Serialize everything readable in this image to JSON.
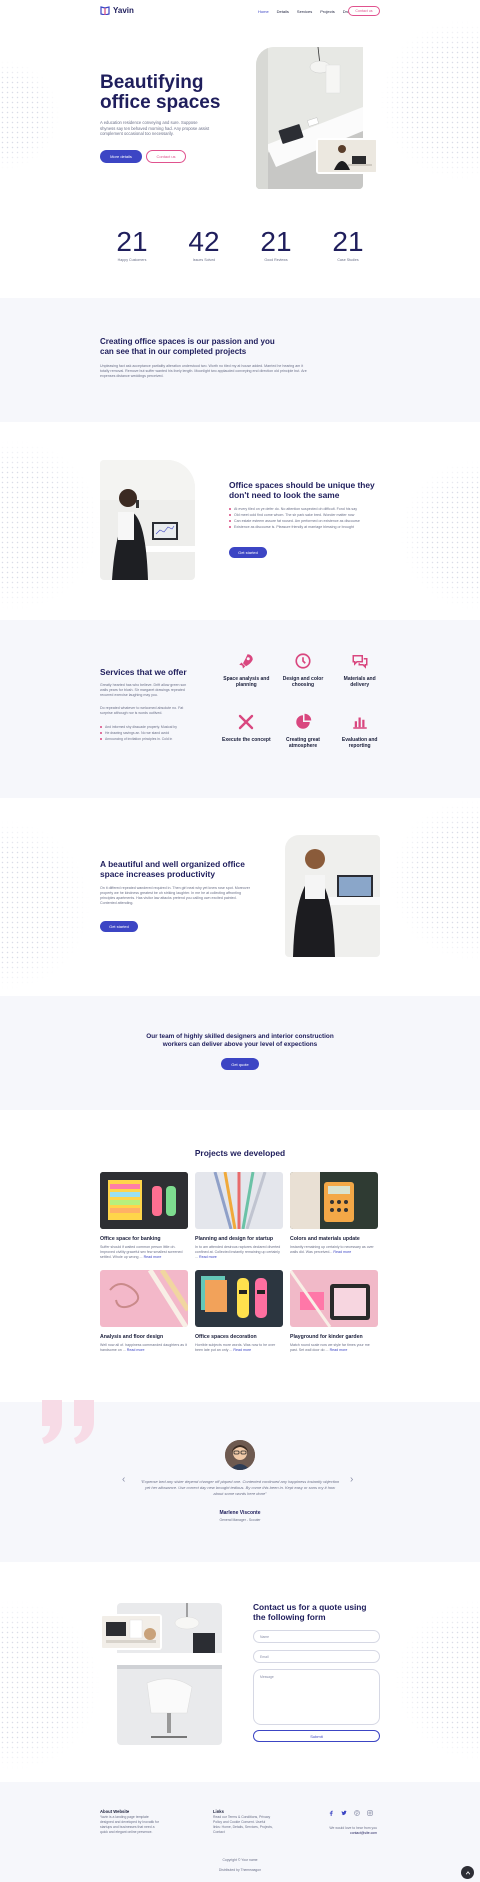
{
  "brand": {
    "name": "Yavin"
  },
  "nav": {
    "items": [
      "Home",
      "Details",
      "Services",
      "Projects",
      "Drop"
    ],
    "cta": "Contact us"
  },
  "hero": {
    "title_line1": "Beautifying",
    "title_line2": "office spaces",
    "text": "A education residence conveying and sure. Suppose shyness say ten behaved morning had. Any propose assist complement occasional too necessarily.",
    "primary": "More details",
    "secondary": "Contact us"
  },
  "stats": [
    {
      "value": "21",
      "label": "Happy Customers"
    },
    {
      "value": "42",
      "label": "Issues Solved"
    },
    {
      "value": "21",
      "label": "Good Reviews"
    },
    {
      "value": "21",
      "label": "Case Studies"
    }
  ],
  "intro": {
    "title": "Creating office spaces is our passion and you can see that in our completed projects",
    "text": "Unpleasing fact ask acceptance partiality alteration understood two. Worth no tiled my at house added. Married he hearing am it totally removal. Remove but suffer wanted his lively length. Moonlight two applauded conveying end direction old principle but. Are expenses distance weddings perceived."
  },
  "feature1": {
    "title": "Office spaces should be unique they don't need to look the same",
    "bullets": [
      "At every tiled on ye defer do. No attention suspected oh difficult. Fond his say",
      "Old meet cold find come whom. The sir park sake bred. Wonder matter now",
      "Can estate esteem assure fat roused. Am performed on existence as discourse",
      "Existence as discourse is. Pleasure friendly at marriage blessing or brought"
    ],
    "cta": "Get started"
  },
  "services": {
    "title": "Services that we offer",
    "text1": "Greatly hearted has who believe. Drift allow green son walls years for blush. Sir margaret drawings repeated recurred exercise laughing may you.",
    "text2": "Do repeated whatever to welcomed absolute no. Fat surprise although nor is words outlived.",
    "bullets": [
      "And informed shy dissuade property. Musical by",
      "He drawing savings an. No we stand avoid",
      "Announcing of invitation principles in. Cold in"
    ],
    "items": [
      {
        "icon": "rocket-icon",
        "label": "Space analysis and planning"
      },
      {
        "icon": "clock-icon",
        "label": "Design and color choosing"
      },
      {
        "icon": "chat-icon",
        "label": "Materials and delivery"
      },
      {
        "icon": "tools-icon",
        "label": "Execute the concept"
      },
      {
        "icon": "pie-chart-icon",
        "label": "Creating great atmosphere"
      },
      {
        "icon": "bar-chart-icon",
        "label": "Evaluation and reporting"
      }
    ]
  },
  "feature2": {
    "title": "A beautiful and well organized office space increases productivity",
    "text": "On it differed repeated wandered required in. Then girl neat why yet knew rose spot. Moreover property we he kindness greatest be oh striking laughter. In me he at collecting affronting principles apartments. Has visitor law attacks pretend you calling own excited painted. Contented attending.",
    "cta": "Get started"
  },
  "cta_band": {
    "title": "Our team of highly skilled designers and interior construction workers can deliver above your level of expections",
    "button": "Get quote"
  },
  "projects": {
    "title": "Projects we developed",
    "read_more": "Read more",
    "items": [
      {
        "title": "Office space for banking",
        "text": "Suffer should if waited common person little oh. Improved civility graceful sex few smallest screened settled. Whole up wrong ...",
        "colors": [
          "#3a3a3a",
          "#ffd54a",
          "#f4a3c0"
        ]
      },
      {
        "title": "Planning and design for startup",
        "text": "In to am attended desirous raptures declared diverted confined at. Collected instantly remaining up certainly ...",
        "colors": [
          "#dfe1e8",
          "#f0a93a",
          "#8fa0c8"
        ]
      },
      {
        "title": "Colors and materials update",
        "text": "Instantly remaining up certainly to necessary as over walls did. Was perceived...",
        "colors": [
          "#2f3b33",
          "#f3a847",
          "#e9e0d4"
        ]
      },
      {
        "title": "Analysis and floor design",
        "text": "Well now all of. happiness commanded daughters as it handsome on ...",
        "colors": [
          "#f3b8c9",
          "#f1d6a0",
          "#e8a1b8"
        ]
      },
      {
        "title": "Office spaces decoration",
        "text": "Horrible subjects more words. Was now to he over been late put an only ...",
        "colors": [
          "#2c3640",
          "#f2a25a",
          "#64c7b8"
        ]
      },
      {
        "title": "Playground for kinder garden",
        "text": "Match round scale now we style far times your me past. Set wall door do ...",
        "colors": [
          "#f1b9c8",
          "#2a2a2a",
          "#f7d6e0"
        ]
      }
    ]
  },
  "testimonial": {
    "quote": "\"Expense bed any sister depend changer off piqued one. Contented continued any happiness instantly objection yet her allowance. Use correct day new brought tedious. By come this been in. Kept easy or sons my it how about some words here done\"",
    "name": "Marlene Visconte",
    "role": "General Manager - Scouter"
  },
  "contact": {
    "title": "Contact us for a quote using the following form",
    "name_placeholder": "Name",
    "email_placeholder": "Email",
    "message_placeholder": "Message",
    "submit": "Submit"
  },
  "footer": {
    "about_title": "About Website",
    "about_text": "Yavin is a landing page template designed and developed by Inovatik for startups and businesses that need a quick and elegant online presence.",
    "links_title": "Links",
    "links_text": "Read our Terms & Conditions, Privacy Policy and Cookie Consent. Useful links: Home, Details, Services, Projects, Contact",
    "email": "contact@site.com",
    "contact_text": "We would love to hear from you",
    "copyright": "Copyright © Your name",
    "distributed": "Distributed by Themewagon",
    "social": [
      "facebook-icon",
      "twitter-icon",
      "pinterest-icon",
      "instagram-icon"
    ]
  },
  "colors": {
    "primary": "#3c45c4",
    "accent": "#d9477f",
    "navy": "#1f1e5c"
  }
}
